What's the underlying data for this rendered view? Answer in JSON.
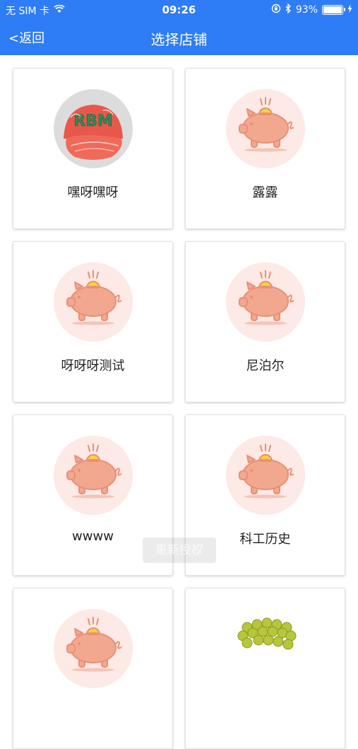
{
  "status_bar": {
    "carrier": "无 SIM 卡",
    "time": "09:26",
    "battery": "93%",
    "icons": [
      "wifi-icon",
      "rotation-lock-icon",
      "bluetooth-icon",
      "battery-icon",
      "charging-icon"
    ]
  },
  "nav": {
    "back_label": "<返回",
    "title": "选择店铺"
  },
  "stores": [
    {
      "name": "嘿呀嘿呀",
      "image": "red-cap-photo"
    },
    {
      "name": "露露",
      "image": "piggy-bank-icon"
    },
    {
      "name": "呀呀呀测试",
      "image": "piggy-bank-icon"
    },
    {
      "name": "尼泊尔",
      "image": "piggy-bank-icon"
    },
    {
      "name": "wwww",
      "image": "piggy-bank-icon"
    },
    {
      "name": "科工历史",
      "image": "piggy-bank-icon"
    },
    {
      "name": "",
      "image": "piggy-bank-icon"
    },
    {
      "name": "",
      "image": "grapes-photo"
    }
  ],
  "toast": {
    "text": "重新授权"
  },
  "colors": {
    "nav_blue": "#2e7cf6",
    "pig_pink": "#f2a88f",
    "coin_yellow": "#f9d33a",
    "avatar_bg": "#fde9e6"
  }
}
